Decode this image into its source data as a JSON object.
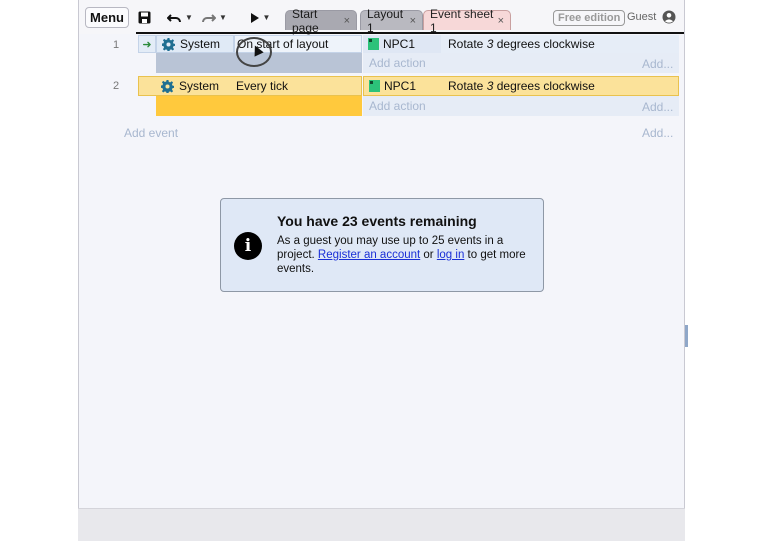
{
  "toolbar": {
    "menu_label": "Menu",
    "tabs": [
      {
        "label": "Start page",
        "close": "×"
      },
      {
        "label": "Layout 1",
        "close": "×"
      },
      {
        "label": "Event sheet 1",
        "close": "×"
      }
    ],
    "edition_badge": "Free edition",
    "user_label": "Guest"
  },
  "events": [
    {
      "number": "1",
      "condition_object": "System",
      "condition_text": "On start of layout",
      "action_object": "NPC1",
      "action_prefix": "Rotate ",
      "action_value": "3",
      "action_suffix": " degrees clockwise",
      "add_action": "Add action",
      "add_right": "Add..."
    },
    {
      "number": "2",
      "condition_object": "System",
      "condition_text": "Every tick",
      "action_object": "NPC1",
      "action_prefix": "Rotate ",
      "action_value": "3",
      "action_suffix": " degrees clockwise",
      "add_action": "Add action",
      "add_right": "Add..."
    }
  ],
  "add_event": {
    "label": "Add event",
    "add_right": "Add..."
  },
  "notice": {
    "title": "You have 23 events remaining",
    "text_1": "As a guest you may use up to 25 events in a project. ",
    "link_register": "Register an account",
    "text_2": " or ",
    "link_login": "log in",
    "text_3": " to get more events."
  },
  "colors": {
    "selected_event": "#fbe29a",
    "selected_event_strip": "#ffc93d",
    "notice_bg": "#dfe8f6",
    "link": "#1a2fd6"
  },
  "icons": {
    "undo": "undo-icon",
    "redo": "redo-icon",
    "save": "save-icon",
    "play": "play-icon",
    "system": "gear-icon",
    "info": "info-icon",
    "user": "user-icon"
  }
}
